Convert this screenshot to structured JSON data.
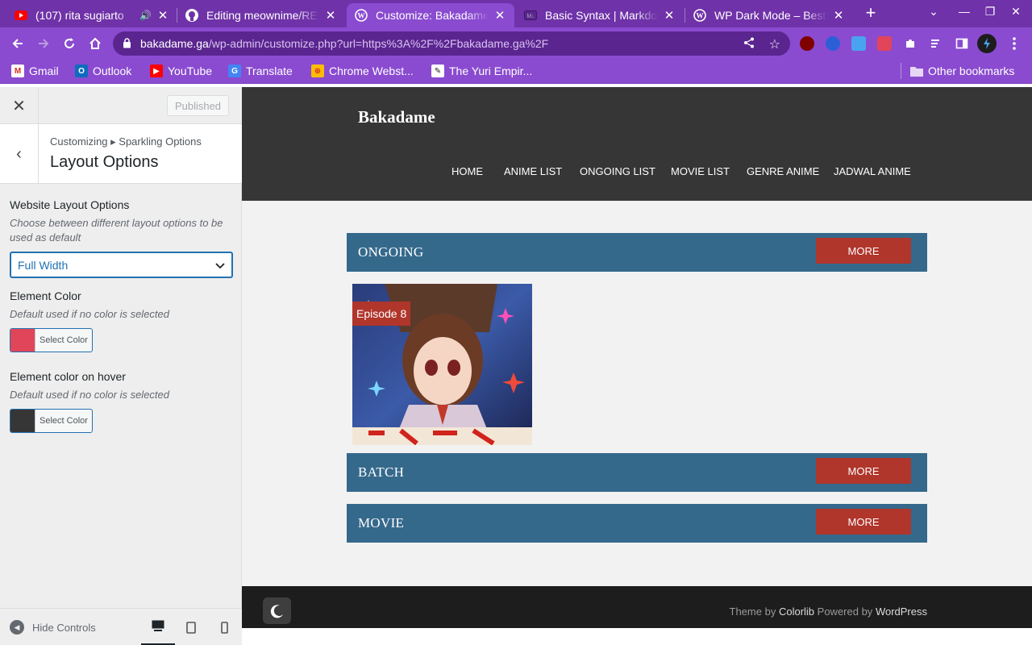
{
  "browser": {
    "tabs": [
      {
        "title": "(107) rita sugiarto",
        "favicon": "youtube-icon",
        "audio": true
      },
      {
        "title": "Editing meownime/RE",
        "favicon": "github-icon"
      },
      {
        "title": "Customize: Bakadame",
        "favicon": "wordpress-icon",
        "active": true
      },
      {
        "title": "Basic Syntax | Markdo",
        "favicon": "markdown-icon"
      },
      {
        "title": "WP Dark Mode – Best",
        "favicon": "wordpress-icon"
      }
    ],
    "url_host": "bakadame.ga",
    "url_path": "/wp-admin/customize.php?url=https%3A%2F%2Fbakadame.ga%2F",
    "bookmarks": [
      {
        "label": "Gmail",
        "icon": "gmail-icon"
      },
      {
        "label": "Outlook",
        "icon": "outlook-icon"
      },
      {
        "label": "YouTube",
        "icon": "youtube-icon"
      },
      {
        "label": "Translate",
        "icon": "translate-icon"
      },
      {
        "label": "Chrome Webst...",
        "icon": "chrome-webstore-icon"
      },
      {
        "label": "The Yuri Empir...",
        "icon": "bookmark-site-icon"
      }
    ],
    "other_bookmarks": "Other bookmarks"
  },
  "customizer": {
    "published_label": "Published",
    "breadcrumb": "Customizing ▸ Sparkling Options",
    "section_title": "Layout Options",
    "layout_label": "Website Layout Options",
    "layout_desc": "Choose between different layout options to be used as default",
    "layout_value": "Full Width",
    "element_color_label": "Element Color",
    "element_color_desc": "Default used if no color is selected",
    "element_color_value": "#e0455a",
    "hover_color_label": "Element color on hover",
    "hover_color_desc": "Default used if no color is selected",
    "hover_color_value": "#363636",
    "select_color_label": "Select Color",
    "hide_controls": "Hide Controls"
  },
  "site": {
    "title": "Bakadame",
    "nav": [
      "HOME",
      "ANIME LIST",
      "ONGOING LIST",
      "MOVIE LIST",
      "GENRE ANIME",
      "JADWAL ANIME"
    ],
    "sections": [
      {
        "title": "ONGOING",
        "more": "MORE"
      },
      {
        "title": "BATCH",
        "more": "MORE"
      },
      {
        "title": "MOVIE",
        "more": "MORE"
      }
    ],
    "episode_badge": "Episode 8",
    "footer_prefix": "Theme by",
    "footer_theme": "Colorlib",
    "footer_mid": "Powered by",
    "footer_wp": "WordPress"
  },
  "colors": {
    "browser_frame": "#6f32a8",
    "browser_toolbar": "#8a4bd0",
    "site_header": "#363636",
    "section_bar": "#35698c",
    "more_button": "#b0352b",
    "wp_blue": "#2271b1"
  }
}
